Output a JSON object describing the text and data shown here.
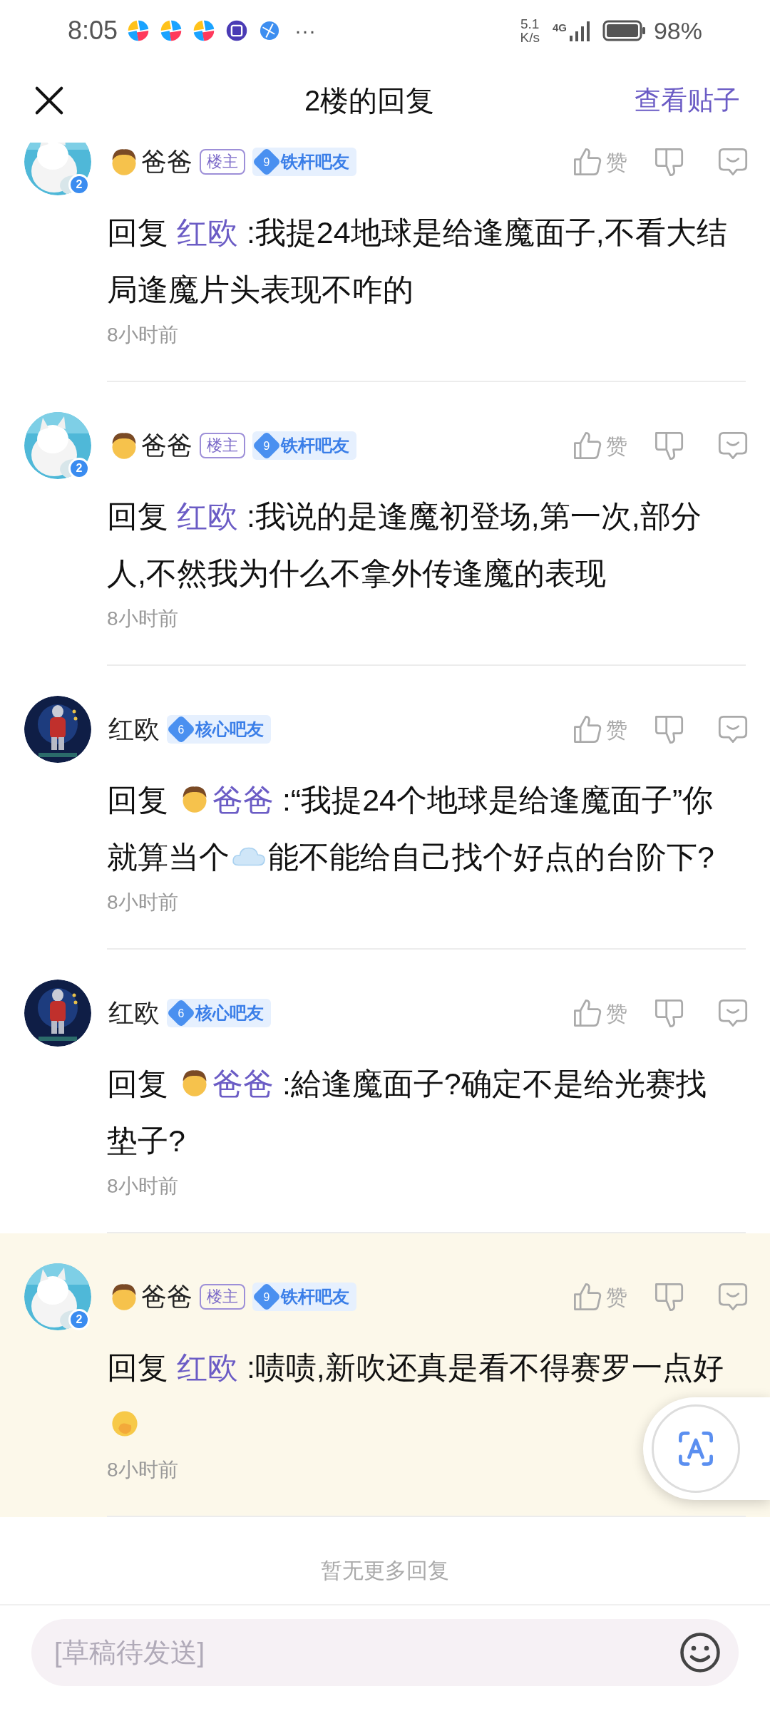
{
  "status_bar": {
    "time": "8:05",
    "notification_icons": [
      {
        "kind": "colorful"
      },
      {
        "kind": "colorful"
      },
      {
        "kind": "colorful"
      },
      {
        "kind": "tieba"
      },
      {
        "kind": "globe"
      }
    ],
    "more": "···",
    "net_speed_value": "5.1",
    "net_speed_unit": "K/s",
    "network": "4G",
    "battery": "98%"
  },
  "header": {
    "title": "2楼的回复",
    "action": "查看贴子"
  },
  "comments": [
    {
      "avatar": {
        "kind": "cat"
      },
      "avatar_badge": "2",
      "author_emoji": true,
      "author": "爸爸",
      "op_tag": "楼主",
      "level": "9",
      "level_title": "铁杆吧友",
      "like": "赞",
      "body": [
        {
          "kind": "text",
          "text": "回复 "
        },
        {
          "kind": "link",
          "text": "红欧"
        },
        {
          "kind": "text",
          "text": " :我提24地球是给逢魔面子,不看大结局逢魔片头表现不咋的"
        }
      ],
      "time": "8小时前",
      "highlighted": false
    },
    {
      "avatar": {
        "kind": "cat"
      },
      "avatar_badge": "2",
      "author_emoji": true,
      "author": "爸爸",
      "op_tag": "楼主",
      "level": "9",
      "level_title": "铁杆吧友",
      "like": "赞",
      "body": [
        {
          "kind": "text",
          "text": "回复 "
        },
        {
          "kind": "link",
          "text": "红欧"
        },
        {
          "kind": "text",
          "text": " :我说的是逢魔初登场,第一次,部分人,不然我为什么不拿外传逢魔的表现"
        }
      ],
      "time": "8小时前",
      "highlighted": false
    },
    {
      "avatar": {
        "kind": "hero"
      },
      "author_emoji": false,
      "author": "红欧",
      "level": "6",
      "level_title": "核心吧友",
      "like": "赞",
      "body": [
        {
          "kind": "text",
          "text": "回复 "
        },
        {
          "kind": "man"
        },
        {
          "kind": "link",
          "text": "爸爸"
        },
        {
          "kind": "text",
          "text": " :“我提24个地球是给逢魔面子”你就算当个"
        },
        {
          "kind": "cloud"
        },
        {
          "kind": "text",
          "text": "能不能给自己找个好点的台阶下?"
        }
      ],
      "time": "8小时前",
      "highlighted": false
    },
    {
      "avatar": {
        "kind": "hero"
      },
      "author_emoji": false,
      "author": "红欧",
      "level": "6",
      "level_title": "核心吧友",
      "like": "赞",
      "body": [
        {
          "kind": "text",
          "text": "回复 "
        },
        {
          "kind": "man"
        },
        {
          "kind": "link",
          "text": "爸爸"
        },
        {
          "kind": "text",
          "text": " :給逢魔面子?确定不是给光赛找垫子?"
        }
      ],
      "time": "8小时前",
      "highlighted": false
    },
    {
      "avatar": {
        "kind": "cat"
      },
      "avatar_badge": "2",
      "author_emoji": true,
      "author": "爸爸",
      "op_tag": "楼主",
      "level": "9",
      "level_title": "铁杆吧友",
      "like": "赞",
      "body": [
        {
          "kind": "text",
          "text": "回复 "
        },
        {
          "kind": "link",
          "text": "红欧"
        },
        {
          "kind": "text",
          "text": " :啧啧,新吹还真是看不得赛罗一点好"
        },
        {
          "kind": "hand-over-mouth"
        }
      ],
      "time": "8小时前",
      "highlighted": true
    }
  ],
  "end_note": "暂无更多回复",
  "input": {
    "placeholder": "[草稿待发送]"
  }
}
